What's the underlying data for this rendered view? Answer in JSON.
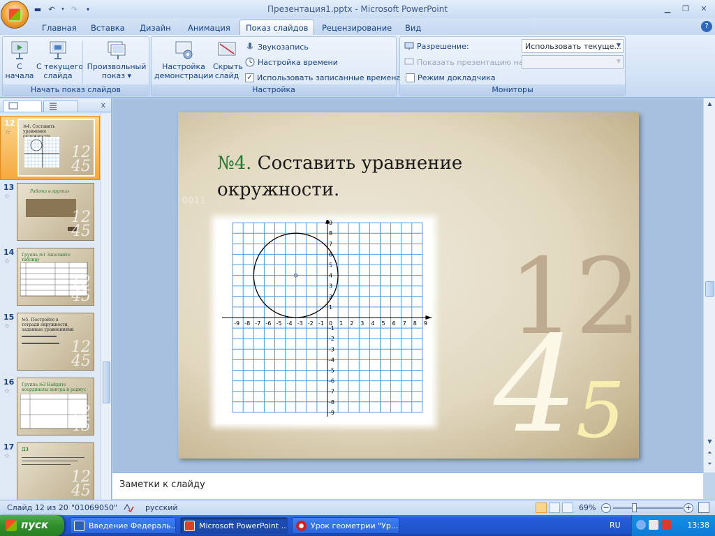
{
  "window": {
    "title": "Презентация1.pptx - Microsoft PowerPoint",
    "quick_access": [
      "save-icon",
      "undo-icon",
      "redo-icon",
      "customize-icon"
    ]
  },
  "tabs": [
    "Главная",
    "Вставка",
    "Дизайн",
    "Анимация",
    "Показ слайдов",
    "Рецензирование",
    "Вид"
  ],
  "active_tab": "Показ слайдов",
  "ribbon": {
    "start_group": {
      "label": "Начать показ слайдов",
      "from_start": "С\nначала",
      "from_current": "С текущего\nслайда",
      "custom": "Произвольный\nпоказ ▾"
    },
    "setup_group": {
      "label": "Настройка",
      "setup_show": "Настройка\nдемонстрации",
      "hide_slide": "Скрыть\nслайд",
      "record_narration": "Звукозапись",
      "rehearse": "Настройка времени",
      "use_timings": "Использовать записанные времена"
    },
    "monitors_group": {
      "label": "Мониторы",
      "resolution_label": "Разрешение:",
      "resolution_value": "Использовать текуще...",
      "show_on_label": "Показать презентацию на:",
      "presenter_view": "Режим докладчика"
    }
  },
  "thumbnails": [
    {
      "num": "12",
      "title": "№4. Составить уравнение окружности.",
      "selected": true
    },
    {
      "num": "13",
      "title": "Работа в группах",
      "selected": false
    },
    {
      "num": "14",
      "title": "Группа №1 Заполните таблицу",
      "selected": false
    },
    {
      "num": "15",
      "title": "№5. Постройте в тетради окружности, заданные уравнениями",
      "selected": false
    },
    {
      "num": "16",
      "title": "Группа №3 Найдите координаты центра и радиус",
      "selected": false
    },
    {
      "num": "17",
      "title": "ДЗ",
      "selected": false
    }
  ],
  "main": {
    "slide": {
      "title_num": "№4.",
      "title_text": " Составить уравнение окружности.",
      "code": "0011",
      "deco_12": "12",
      "deco_4": "4",
      "deco_5": "5",
      "grid": {
        "x_ticks": [
          "-9",
          "-8",
          "-7",
          "-6",
          "-5",
          "-4",
          "-3",
          "-2",
          "-1",
          "0",
          "1",
          "2",
          "3",
          "4",
          "5",
          "6",
          "7",
          "8",
          "9"
        ],
        "y_ticks": [
          "9",
          "8",
          "7",
          "6",
          "5",
          "4",
          "3",
          "2",
          "1",
          "-1",
          "-2",
          "-3",
          "-4",
          "-5",
          "-6",
          "-7",
          "-8",
          "-9"
        ],
        "circle_center": [
          -3,
          4
        ],
        "circle_radius": 4
      }
    },
    "notes_placeholder": "Заметки к слайду"
  },
  "status": {
    "slide_info": "Слайд 12 из 20",
    "theme": "\"01069050\"",
    "language": "русский",
    "zoom": "69%"
  },
  "taskbar": {
    "start": "пуск",
    "tasks": [
      "Введение Федераль...",
      "Microsoft PowerPoint ...",
      "Урок геометрии \"Ур..."
    ],
    "lang": "RU",
    "clock": "13:38"
  }
}
